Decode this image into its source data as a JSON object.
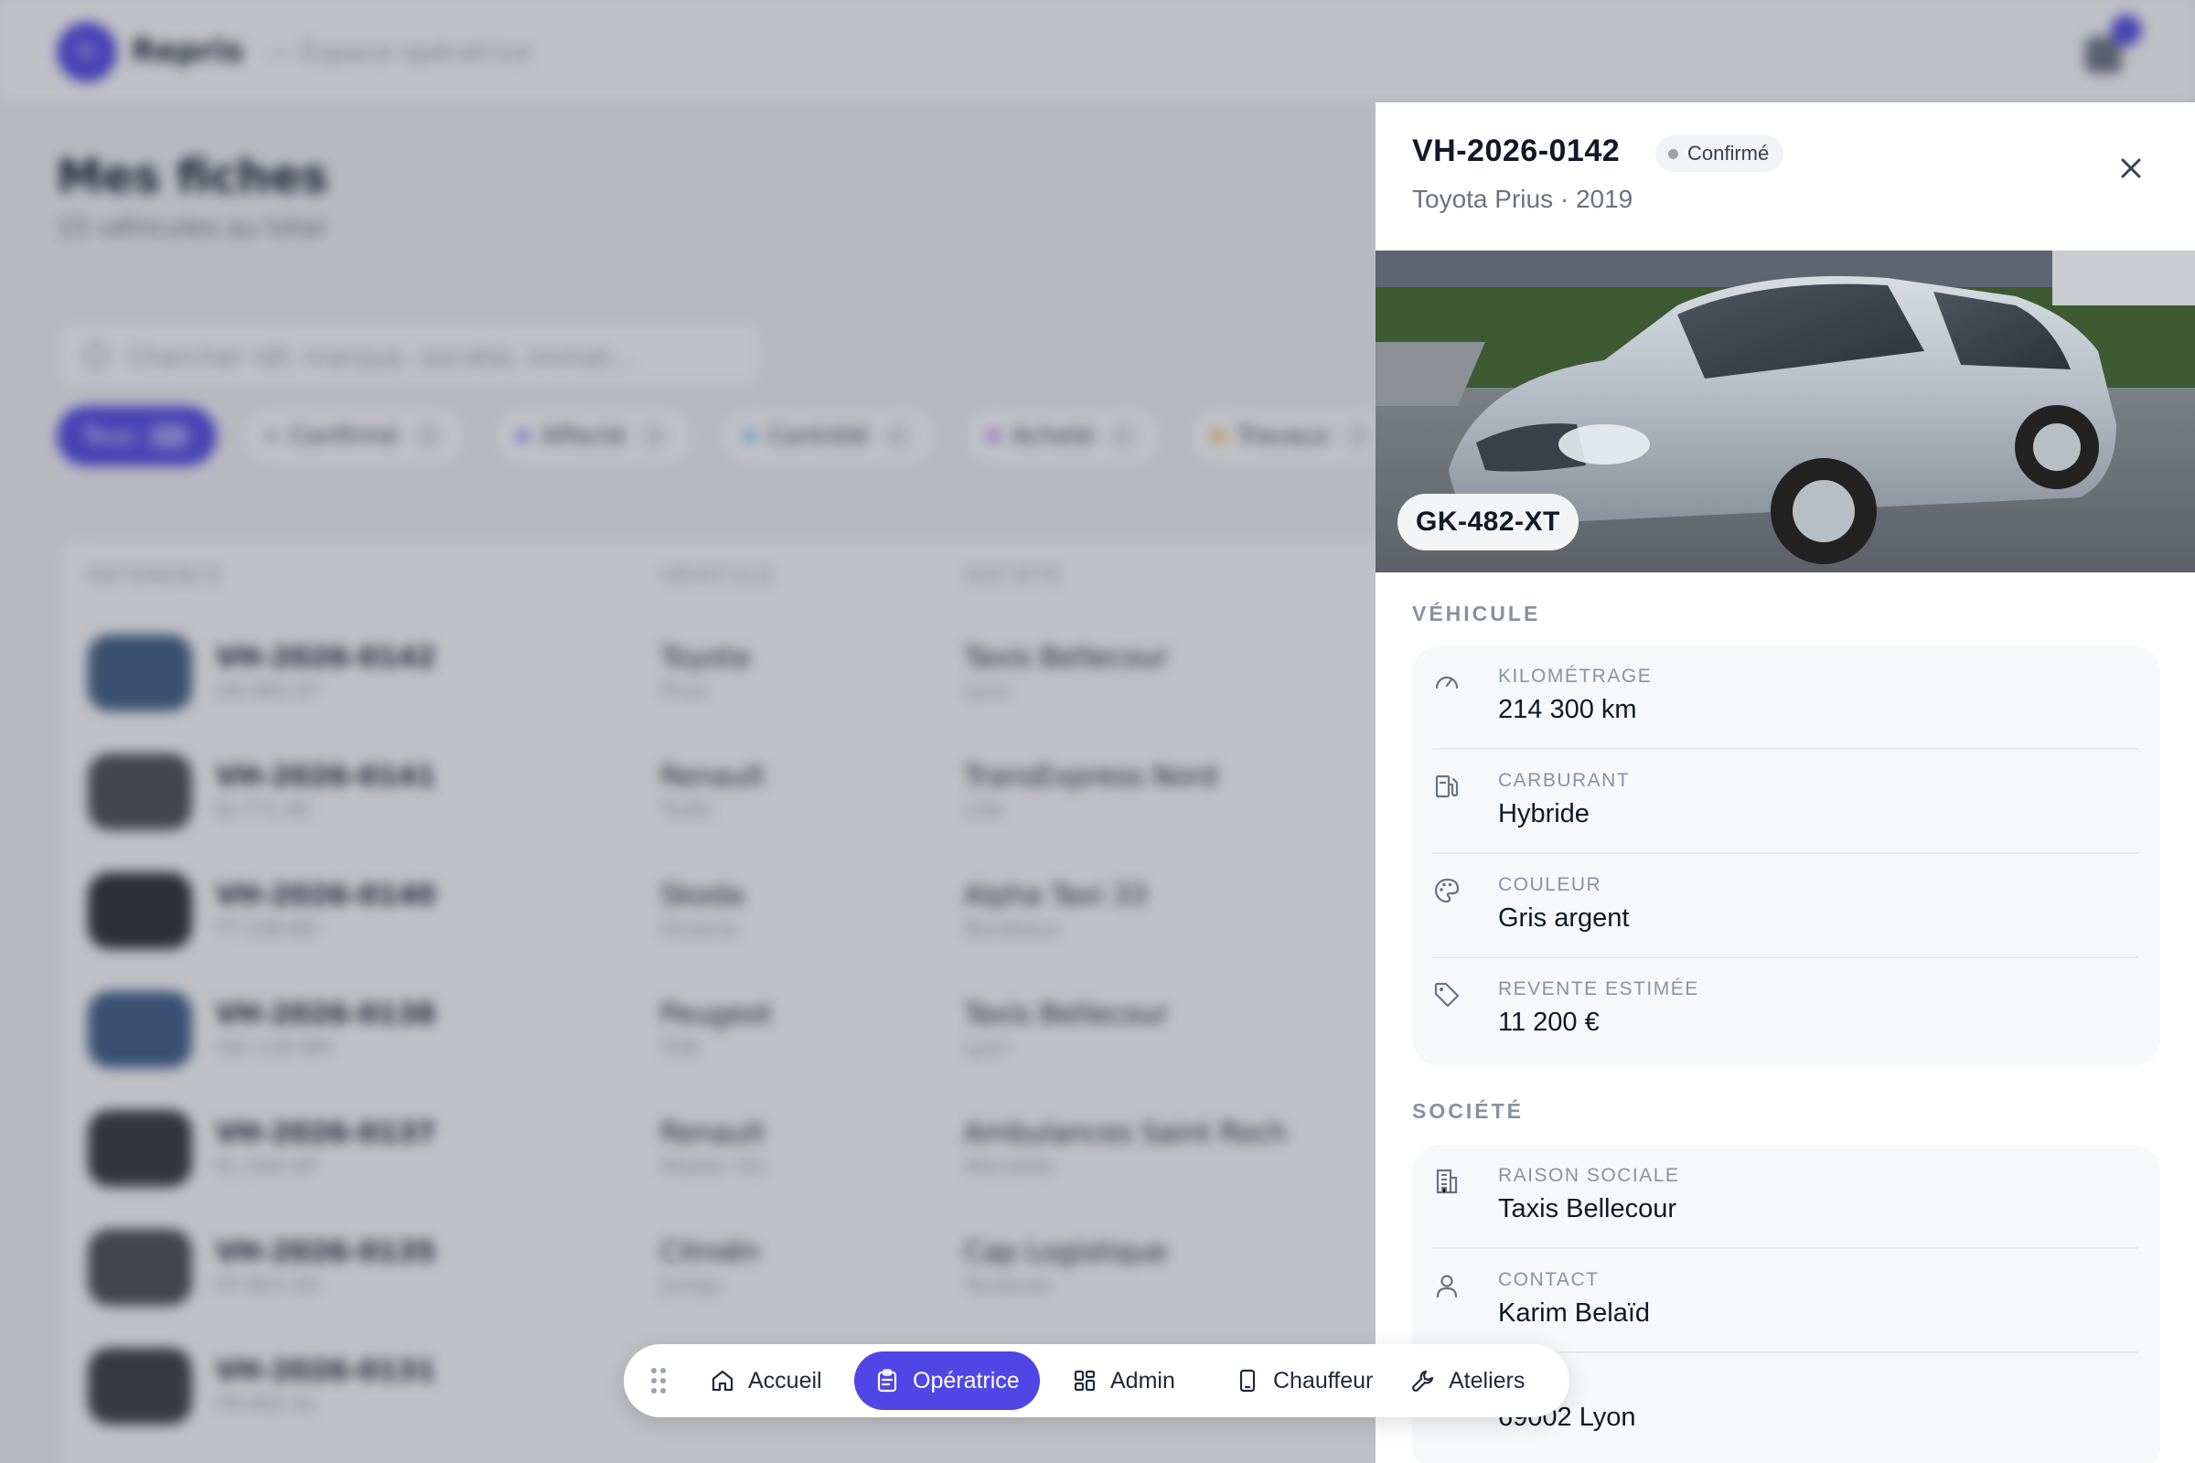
{
  "background": {
    "brand": "Repris",
    "breadcrumb": "— Espace opératrice",
    "page_title": "Mes fiches",
    "page_subtitle": "15 véhicules au total",
    "search_placeholder": "Chercher réf, marque, société, immat…",
    "filters": [
      {
        "label": "Tous",
        "count": "15",
        "active": true,
        "color": ""
      },
      {
        "label": "Confirmé",
        "count": "3",
        "active": false,
        "color": "#9ca3af"
      },
      {
        "label": "Affecté",
        "count": "2",
        "active": false,
        "color": "#6366f1"
      },
      {
        "label": "Contrôlé",
        "count": "2",
        "active": false,
        "color": "#38bdf8"
      },
      {
        "label": "Acheté",
        "count": "2",
        "active": false,
        "color": "#a855f7"
      },
      {
        "label": "Travaux",
        "count": "2",
        "active": false,
        "color": "#f59e0b"
      }
    ],
    "columns": [
      "RÉFÉRENCE",
      "VÉHICULE",
      "SOCIÉTÉ"
    ],
    "rows": [
      {
        "ref": "VH-2026-0142",
        "plate": "GK-482-XT",
        "make": "Toyota",
        "model": "Prius",
        "company": "Taxis Bellecour",
        "city": "Lyon",
        "thumb": "#3d5a80"
      },
      {
        "ref": "VH-2026-0141",
        "plate": "EJ-771-RC",
        "make": "Renault",
        "model": "Trafic",
        "company": "TransExpress Nord",
        "city": "Lille",
        "thumb": "#4b4b4b"
      },
      {
        "ref": "VH-2026-0140",
        "plate": "FT-339-BD",
        "make": "Skoda",
        "model": "Octavia",
        "company": "Alpha Taxi 33",
        "city": "Bordeaux",
        "thumb": "#2a2a2a"
      },
      {
        "ref": "VH-2026-0138",
        "plate": "GD-118-NM",
        "make": "Peugeot",
        "model": "508",
        "company": "Taxis Bellecour",
        "city": "Lyon",
        "thumb": "#3b5b85"
      },
      {
        "ref": "VH-2026-0137",
        "plate": "EL-540-KP",
        "make": "Renault",
        "model": "Master Vtc",
        "company": "Ambulances Saint Roch",
        "city": "Marseille",
        "thumb": "#333333"
      },
      {
        "ref": "VH-2026-0135",
        "plate": "FP-903-ZA",
        "make": "Citroën",
        "model": "Jumpy",
        "company": "Cap Logistique",
        "city": "Toulouse",
        "thumb": "#4a4a4a"
      },
      {
        "ref": "VH-2026-0131",
        "plate": "FR-402-SL",
        "make": "",
        "model": "",
        "company": "",
        "city": "",
        "thumb": "#3a3a3a"
      }
    ]
  },
  "drawer": {
    "reference": "VH-2026-0142",
    "status": "Confirmé",
    "subtitle": "Toyota Prius · 2019",
    "plate": "GK-482-XT",
    "vehicle_section": "VÉHICULE",
    "vehicle_items": [
      {
        "icon": "gauge-icon",
        "label": "KILOMÉTRAGE",
        "value": "214 300 km"
      },
      {
        "icon": "fuel-pump-icon",
        "label": "CARBURANT",
        "value": "Hybride"
      },
      {
        "icon": "palette-icon",
        "label": "COULEUR",
        "value": "Gris argent"
      },
      {
        "icon": "tag-icon",
        "label": "REVENTE ESTIMÉE",
        "value": "11 200 €"
      }
    ],
    "company_section": "SOCIÉTÉ",
    "company_items": [
      {
        "icon": "building-icon",
        "label": "RAISON SOCIALE",
        "value": "Taxis Bellecour"
      },
      {
        "icon": "user-icon",
        "label": "CONTACT",
        "value": "Karim Belaïd"
      },
      {
        "icon": "map-pin-icon",
        "label": "",
        "value": "69002 Lyon"
      }
    ]
  },
  "nav": {
    "items": [
      {
        "label": "Accueil",
        "icon": "home-icon",
        "active": false
      },
      {
        "label": "Opératrice",
        "icon": "clipboard-icon",
        "active": true
      },
      {
        "label": "Admin",
        "icon": "grid-icon",
        "active": false
      },
      {
        "label": "Chauffeur",
        "icon": "phone-icon",
        "active": false
      },
      {
        "label": "Ateliers",
        "icon": "wrench-icon",
        "active": false
      }
    ]
  },
  "colors": {
    "accent": "#4f46e5",
    "overlay": "#373c4e"
  }
}
